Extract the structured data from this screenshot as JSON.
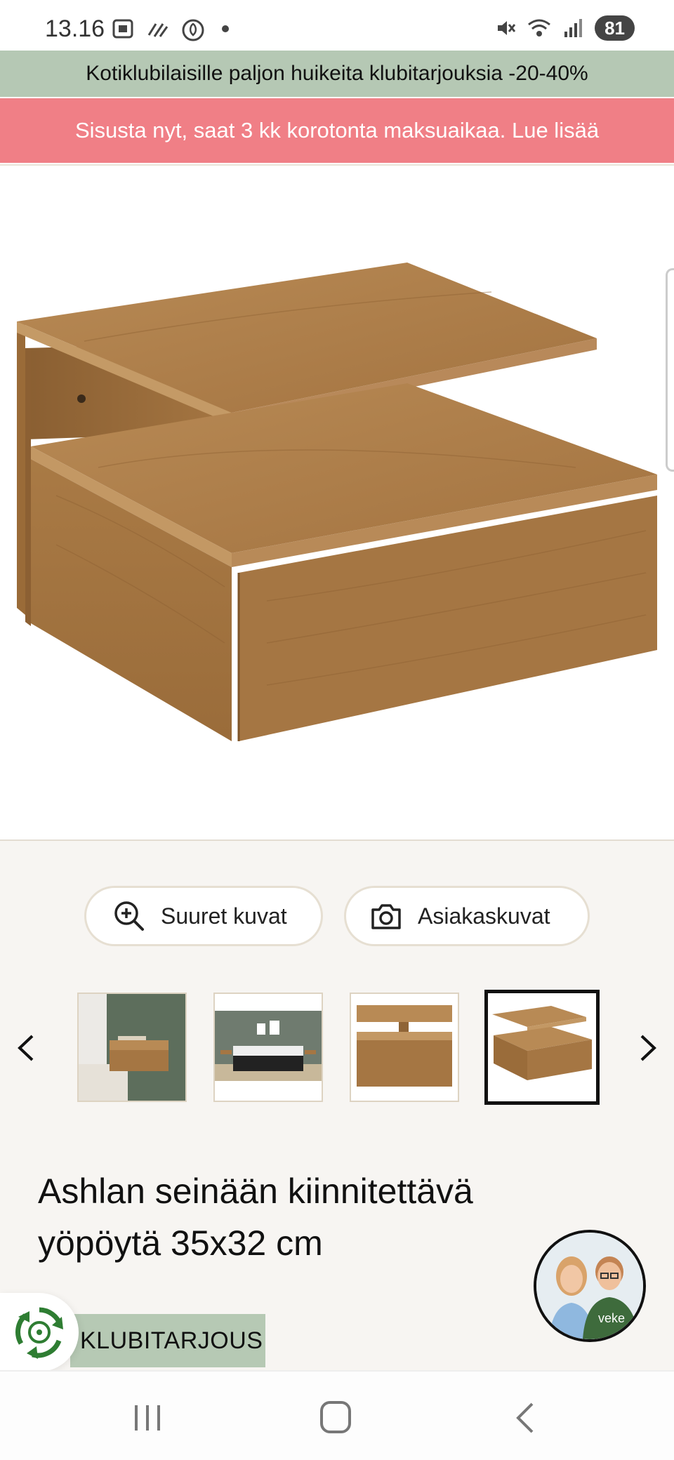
{
  "status_bar": {
    "time": "13.16",
    "battery": "81",
    "left_icons": [
      "screenshot-icon",
      "wifi-calling-icon",
      "leaf-app-icon",
      "dot-icon"
    ],
    "right_icons": [
      "mute-icon",
      "wifi-icon",
      "signal-icon"
    ]
  },
  "banners": {
    "club_offer": "Kotiklubilaisille paljon huikeita klubitarjouksia -20-40%",
    "financing": "Sisusta nyt, saat 3 kk korotonta maksuaikaa. Lue lisää"
  },
  "gallery": {
    "large_images_label": "Suuret kuvat",
    "customer_images_label": "Asiakaskuvat",
    "thumbnails": [
      "thumb-wall-mounted",
      "thumb-bedroom",
      "thumb-front",
      "thumb-angle"
    ],
    "selected_index": 3
  },
  "product": {
    "title": "Ashlan seinään kiinnitettävä yöpöytä 35x32 cm",
    "badge": "KLUBITARJOUS"
  },
  "chat": {
    "avatar_text": "veke"
  },
  "colors": {
    "club_banner": "#b5c8b4",
    "financing_banner": "#f07f86",
    "gallery_bg": "#f7f5f2",
    "wood": "#a97a45"
  }
}
